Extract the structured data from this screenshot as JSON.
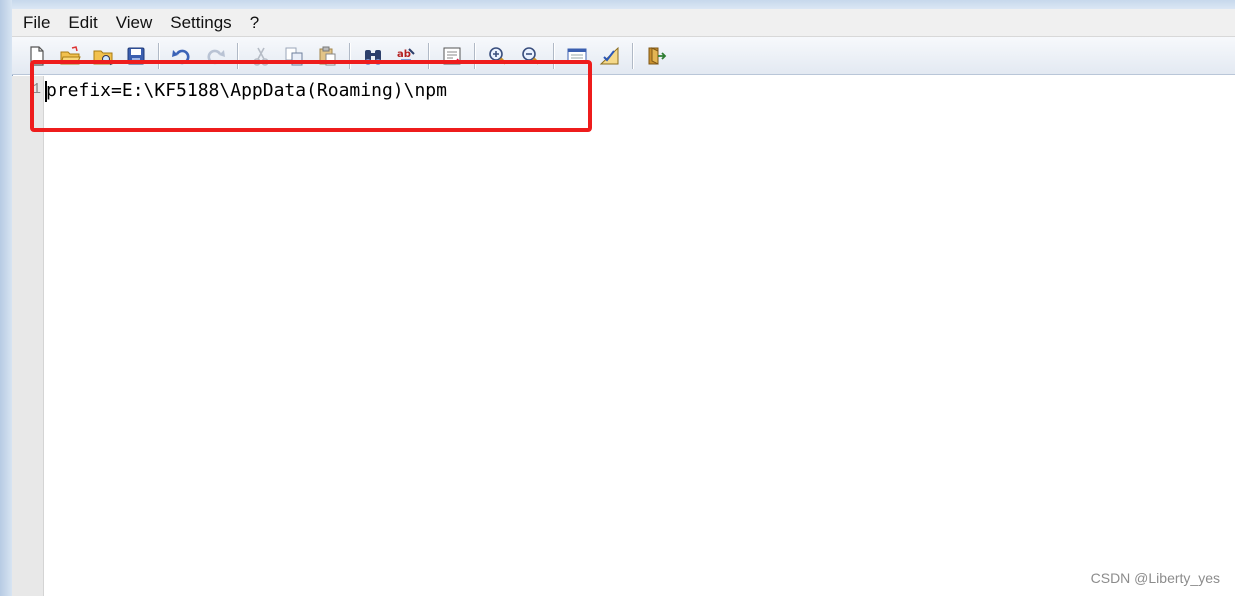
{
  "menu": {
    "items": [
      {
        "label": "File"
      },
      {
        "label": "Edit"
      },
      {
        "label": "View"
      },
      {
        "label": "Settings"
      },
      {
        "label": "?"
      }
    ]
  },
  "toolbar": {
    "buttons": [
      "new-file-icon",
      "open-file-icon",
      "browse-folder-icon",
      "save-icon",
      "undo-icon",
      "redo-icon",
      "cut-icon",
      "copy-icon",
      "paste-icon",
      "find-icon",
      "replace-icon",
      "goto-icon",
      "zoom-in-icon",
      "zoom-out-icon",
      "properties-icon",
      "options-icon",
      "exit-icon"
    ]
  },
  "editor": {
    "line_number": "1",
    "line_text": "prefix=E:\\KF5188\\AppData(Roaming)\\npm"
  },
  "annotation": {
    "color": "#ee1c1c"
  },
  "watermark": {
    "text": "CSDN @Liberty_yes"
  }
}
